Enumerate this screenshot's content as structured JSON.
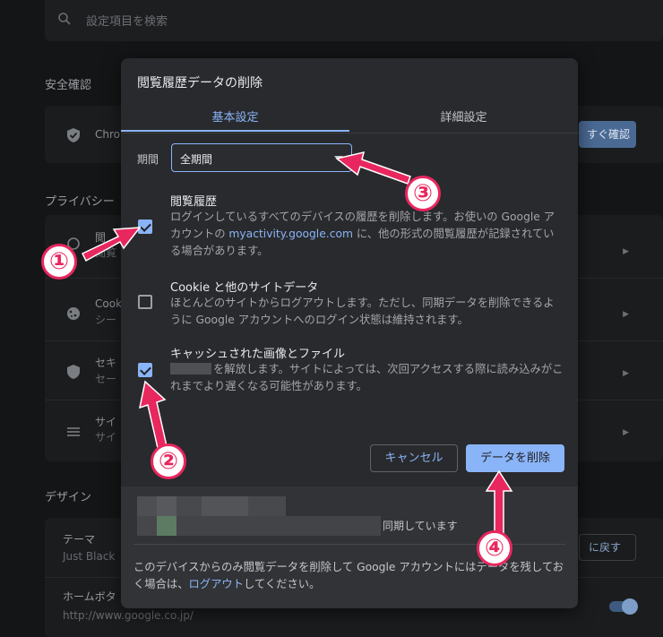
{
  "background": {
    "search_placeholder": "設定項目を検索",
    "safety_title": "安全確認",
    "safety_row_text": "Chro",
    "safety_button": "すぐ確認",
    "privacy_title": "プライバシー",
    "privacy_rows": [
      {
        "label": "閲",
        "sub": "閲覧"
      },
      {
        "label": "Cook",
        "sub": "シー"
      },
      {
        "label": "セキ",
        "sub": "セー"
      },
      {
        "label": "サイ",
        "sub": "サイ"
      }
    ],
    "design_title": "デザイン",
    "theme_label": "テーマ",
    "theme_sub": "Just Black",
    "theme_reset_button": "に戻す",
    "home_label": "ホームボタ",
    "home_sub": "http://www.google.co.jp/"
  },
  "dialog": {
    "title": "閲覧履歴データの削除",
    "tabs": [
      {
        "label": "基本設定",
        "active": true
      },
      {
        "label": "詳細設定",
        "active": false
      }
    ],
    "period_label": "期間",
    "period_value": "全期間",
    "options": [
      {
        "title": "閲覧履歴",
        "checked": true,
        "desc_before": "ログインしているすべてのデバイスの履歴を削除します。お使いの Google アカウントの ",
        "desc_link": "myactivity.google.com",
        "desc_after": " に、他の形式の閲覧履歴が記録されている場合があります。"
      },
      {
        "title": "Cookie と他のサイトデータ",
        "checked": false,
        "desc": "ほとんどのサイトからログアウトします。ただし、同期データを削除できるように Google アカウントへのログイン状態は維持されます。"
      },
      {
        "title": "キャッシュされた画像とファイル",
        "checked": true,
        "desc": "を解放します。サイトによっては、次回アクセスする際に読み込みがこれまでより遅くなる可能性があります。"
      }
    ],
    "cancel_label": "キャンセル",
    "delete_label": "データを削除",
    "sync_text": "同期しています",
    "footer_before": "このデバイスからのみ閲覧データを削除して Google アカウントにはデータを残しておく場合は、",
    "footer_link": "ログアウト",
    "footer_after": "してください。"
  },
  "annotations": [
    "①",
    "②",
    "③",
    "④"
  ],
  "colors": {
    "accent": "#8ab4f8",
    "dialog_bg": "#292a2d",
    "annotation": "#e8275f"
  }
}
